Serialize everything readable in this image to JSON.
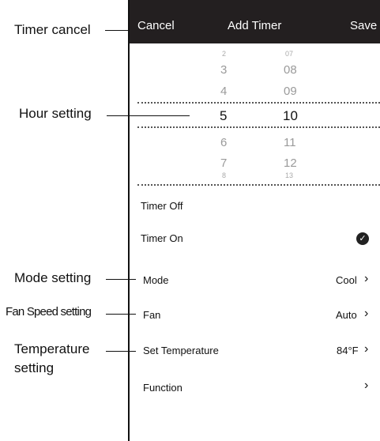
{
  "annotations": {
    "timer_cancel": "Timer cancel",
    "hour_setting": "Hour setting",
    "mode_setting": "Mode setting",
    "fan_speed_setting": "Fan Speed setting",
    "temperature_setting_line1": "Temperature",
    "temperature_setting_line2": "setting"
  },
  "header": {
    "cancel_label": "Cancel",
    "title": "Add Timer",
    "save_label": "Save"
  },
  "picker": {
    "hours": [
      "2",
      "3",
      "4",
      "5",
      "6",
      "7",
      "8"
    ],
    "minutes": [
      "07",
      "08",
      "09",
      "10",
      "11",
      "12",
      "13"
    ],
    "selected_hour": "5",
    "selected_minute": "10"
  },
  "timer_options": {
    "timer_off_label": "Timer Off",
    "timer_on_label": "Timer On",
    "selected": "Timer On"
  },
  "settings": {
    "mode_label": "Mode",
    "mode_value": "Cool",
    "fan_label": "Fan",
    "fan_value": "Auto",
    "temp_label": "Set Temperature",
    "temp_value": "84°F",
    "function_label": "Function"
  }
}
